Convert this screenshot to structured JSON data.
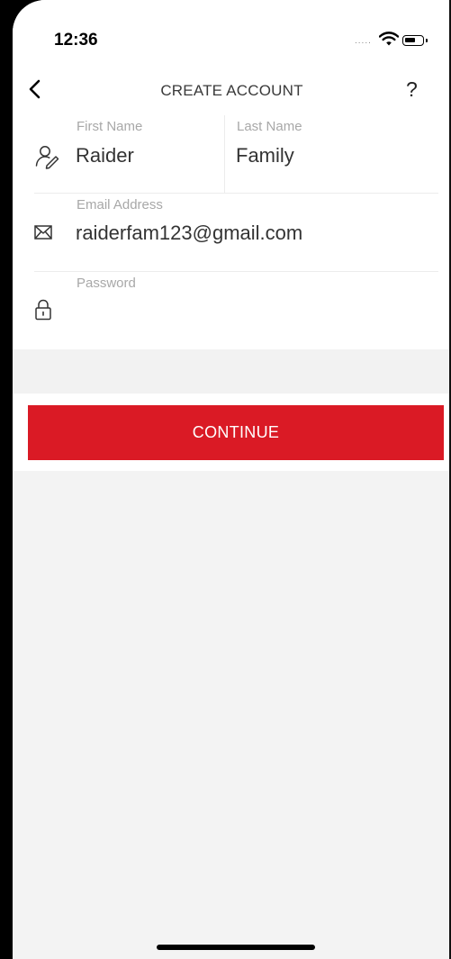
{
  "status_bar": {
    "time": "12:36",
    "signal": "....."
  },
  "header": {
    "title": "CREATE ACCOUNT",
    "help_label": "?"
  },
  "form": {
    "first_name": {
      "label": "First Name",
      "value": "Raider"
    },
    "last_name": {
      "label": "Last Name",
      "value": "Family"
    },
    "email": {
      "label": "Email Address",
      "value": "raiderfam123@gmail.com"
    },
    "password": {
      "label": "Password",
      "value": ""
    }
  },
  "continue_label": "CONTINUE",
  "colors": {
    "accent": "#da1a25",
    "background": "#f3f3f3"
  },
  "icons": {
    "back": "chevron-left-icon",
    "name": "user-edit-icon",
    "email": "envelope-icon",
    "password": "lock-icon"
  }
}
